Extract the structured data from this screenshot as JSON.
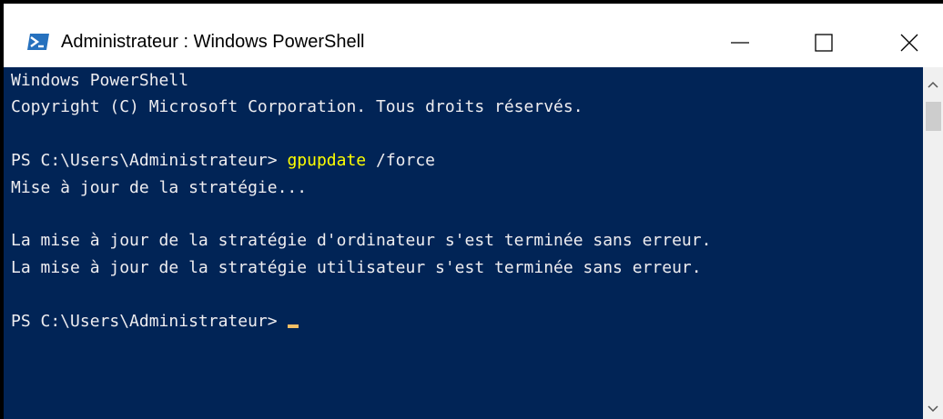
{
  "window": {
    "title": "Administrateur : Windows PowerShell",
    "icon": "powershell-icon",
    "controls": [
      "minimize-icon",
      "maximize-icon",
      "close-icon"
    ]
  },
  "console": {
    "lines": [
      "Windows PowerShell",
      "Copyright (C) Microsoft Corporation. Tous droits réservés.",
      "",
      {
        "prompt": "PS C:\\Users\\Administrateur> ",
        "command": "gpupdate",
        "args": " /force"
      },
      "Mise à jour de la stratégie...",
      "",
      "La mise à jour de la stratégie d'ordinateur s'est terminée sans erreur.",
      "La mise à jour de la stratégie utilisateur s'est terminée sans erreur.",
      "",
      {
        "prompt": "PS C:\\Users\\Administrateur> ",
        "cursor": true
      }
    ]
  },
  "colors": {
    "background": "#012456",
    "text": "#eeedf0",
    "command": "#ffff00",
    "cursor": "#f5bf65"
  }
}
